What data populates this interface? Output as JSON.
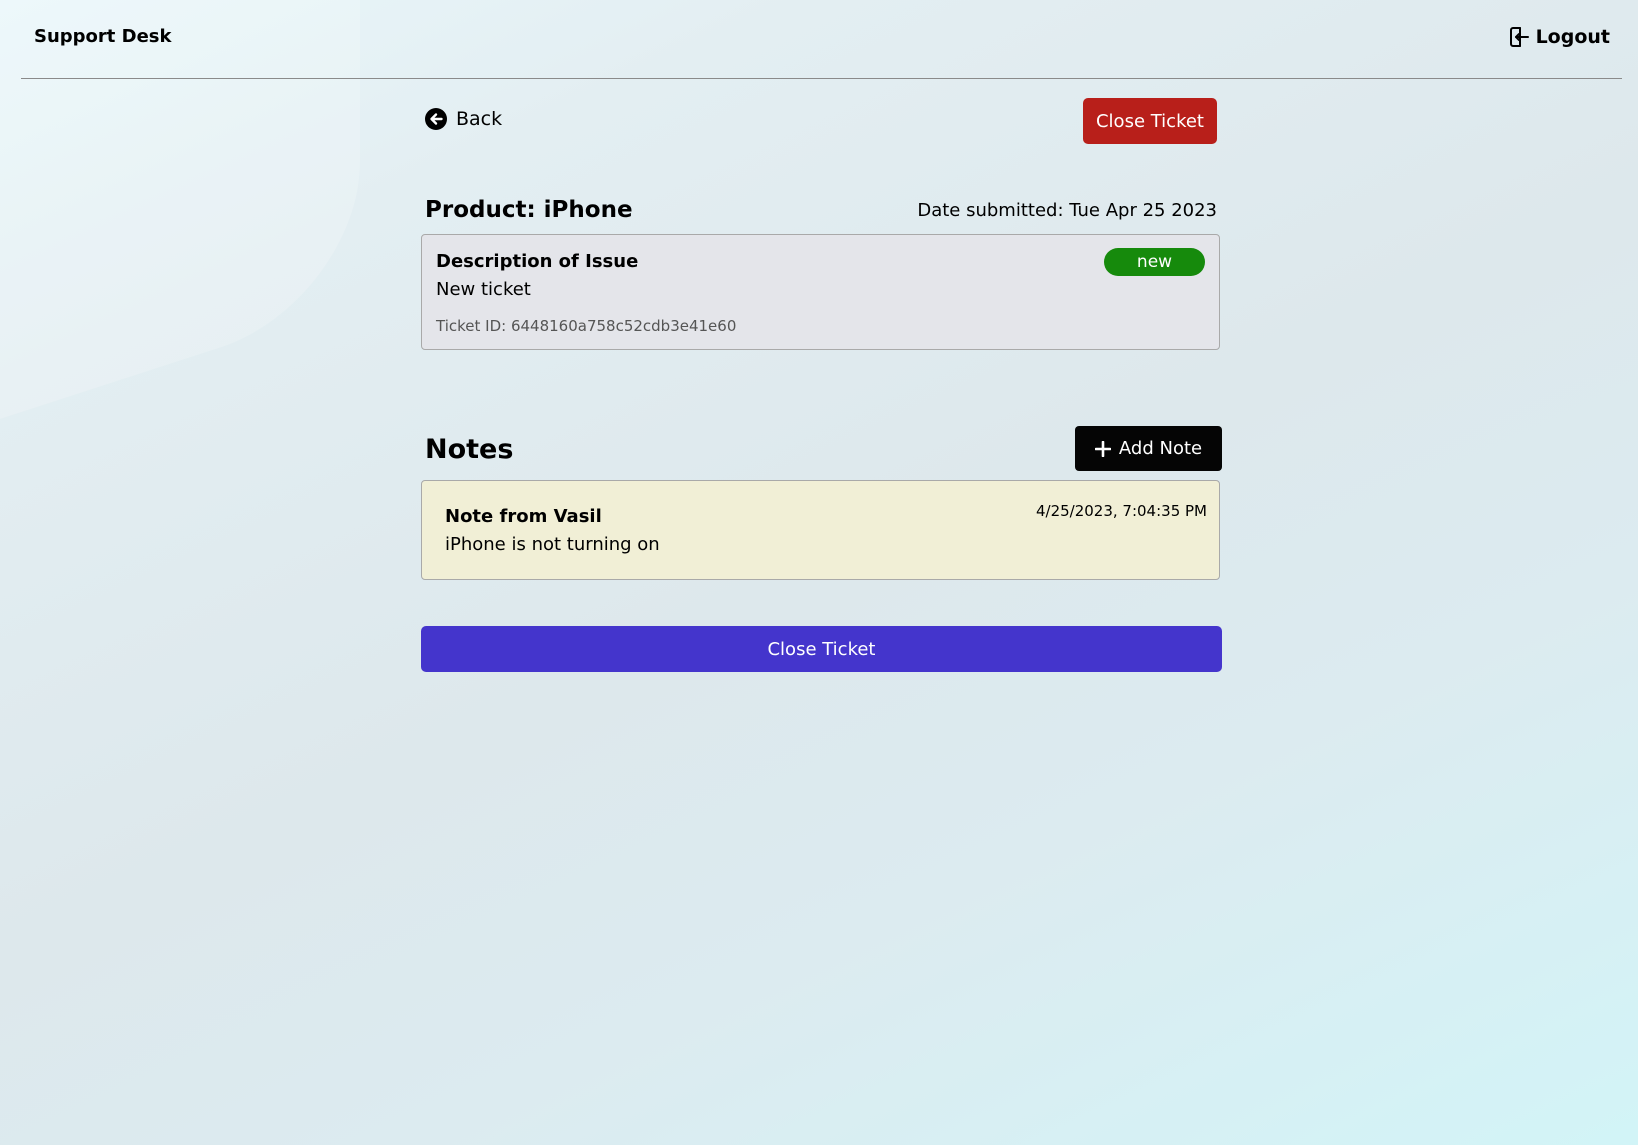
{
  "header": {
    "logo_text": "Support Desk",
    "logout_label": "Logout",
    "logout_icon": "logout-icon"
  },
  "nav": {
    "back_label": "Back",
    "back_icon": "arrow-circle-left-icon"
  },
  "actions": {
    "close_ticket_label": "Close Ticket"
  },
  "ticket": {
    "product_title": "Product: iPhone",
    "date_submitted": "Date submitted: Tue Apr 25 2023",
    "description_label": "Description of Issue",
    "description": "New ticket",
    "ticket_id": "Ticket ID: 6448160a758c52cdb3e41e60",
    "status": "new"
  },
  "notes": {
    "title": "Notes",
    "add_note_label": "Add Note",
    "items": [
      {
        "author": "Note from Vasil",
        "text": "iPhone is not turning on",
        "date": "4/25/2023, 7:04:35 PM"
      }
    ]
  },
  "footer": {
    "close_ticket_label": "Close Ticket"
  },
  "colors": {
    "close_ticket_top": "#b81f1a",
    "close_ticket_bottom": "#4435cc",
    "status_new": "#168a0c",
    "note_background": "#f1efd6",
    "description_background": "#e4e5ea",
    "add_note_button": "#050505"
  }
}
